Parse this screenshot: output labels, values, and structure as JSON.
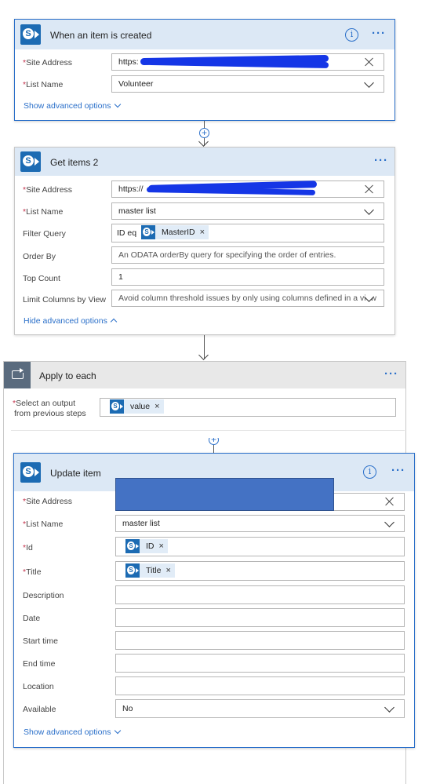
{
  "trigger": {
    "title": "When an item is created",
    "site_address_label": "Site Address",
    "site_address_value": "https:",
    "list_name_label": "List Name",
    "list_name_value": "Volunteer",
    "advanced_link": "Show advanced options"
  },
  "get_items": {
    "title": "Get items 2",
    "site_address_label": "Site Address",
    "site_address_value": "https://",
    "list_name_label": "List Name",
    "list_name_value": "master list",
    "filter_label": "Filter Query",
    "filter_prefix": "ID eq",
    "filter_token": "MasterID",
    "order_label": "Order By",
    "order_placeholder": "An ODATA orderBy query for specifying the order of entries.",
    "top_label": "Top Count",
    "top_value": "1",
    "limit_label": "Limit Columns by View",
    "limit_placeholder": "Avoid column threshold issues by only using columns defined in a view",
    "advanced_link": "Hide advanced options"
  },
  "apply_each": {
    "title": "Apply to each",
    "select_label_1": "Select an output",
    "select_label_2": "from previous steps",
    "token": "value"
  },
  "update_item": {
    "title": "Update item",
    "site_address_label": "Site Address",
    "list_name_label": "List Name",
    "list_name_value": "master list",
    "id_label": "Id",
    "id_token": "ID",
    "title_label": "Title",
    "title_token": "Title",
    "description_label": "Description",
    "date_label": "Date",
    "start_label": "Start time",
    "end_label": "End time",
    "location_label": "Location",
    "available_label": "Available",
    "available_value": "No",
    "advanced_link": "Show advanced options"
  },
  "common": {
    "required_mark": "*",
    "token_remove": "×",
    "more_glyph": "···",
    "info_glyph": "i"
  },
  "colors": {
    "accent": "#2a6fc9",
    "header_bg": "#dce8f5",
    "sharepoint": "#1c6bb3",
    "loop_icon_bg": "#5a6b7e",
    "required": "#c4314b"
  }
}
